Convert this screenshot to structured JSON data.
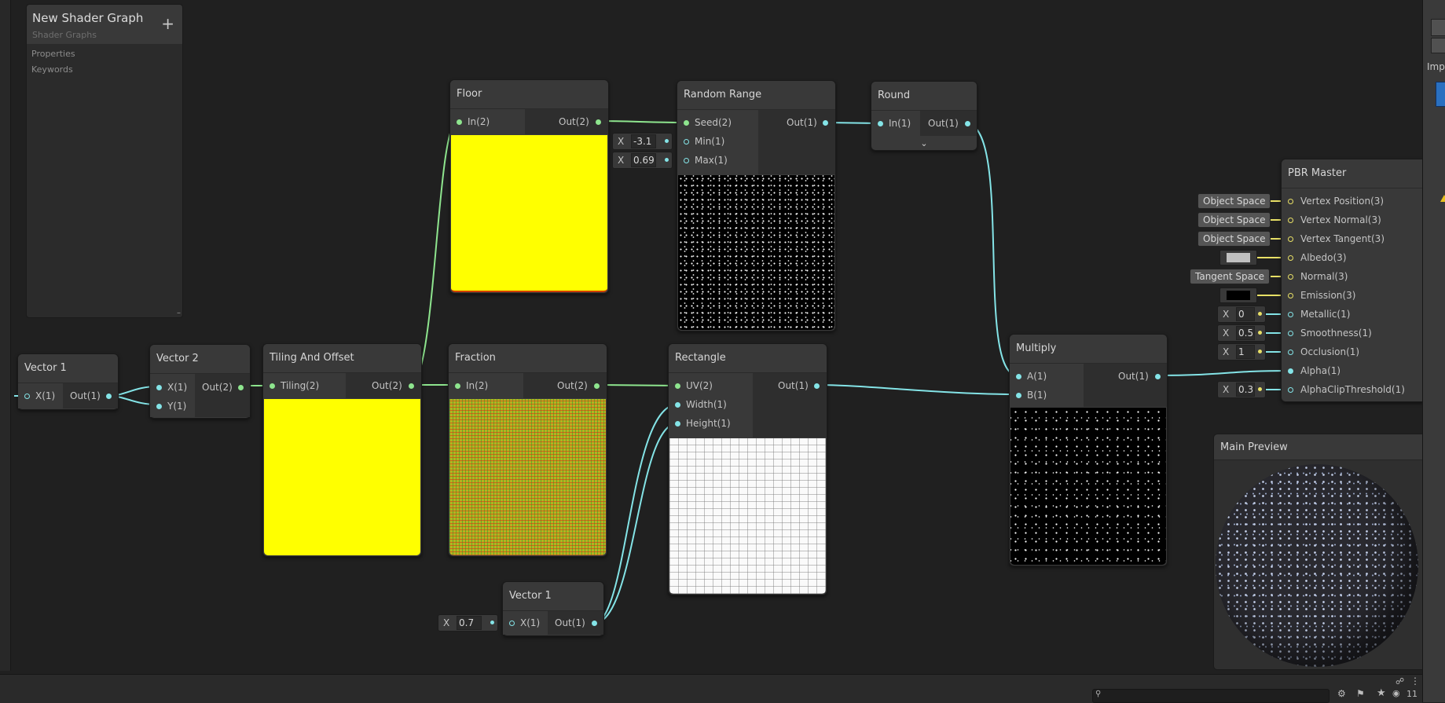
{
  "blackboard": {
    "title": "New Shader Graph",
    "subtitle": "Shader Graphs",
    "add_label": "+",
    "sections": [
      "Properties",
      "Keywords"
    ],
    "collapse_label": "–"
  },
  "nodes": {
    "vector1_a": {
      "title": "Vector 1",
      "in_label": "X(1)",
      "out_label": "Out(1)"
    },
    "vector2": {
      "title": "Vector 2",
      "in": [
        "X(1)",
        "Y(1)"
      ],
      "out_label": "Out(2)"
    },
    "tiling": {
      "title": "Tiling And Offset",
      "in_label": "Tiling(2)",
      "out_label": "Out(2)",
      "preview_color": "#ffff00"
    },
    "floor": {
      "title": "Floor",
      "in_label": "In(2)",
      "out_label": "Out(2)",
      "preview_color": "#ffff00"
    },
    "fraction": {
      "title": "Fraction",
      "in_label": "In(2)",
      "out_label": "Out(2)"
    },
    "random_range": {
      "title": "Random Range",
      "in": [
        "Seed(2)",
        "Min(1)",
        "Max(1)"
      ],
      "out_label": "Out(1)",
      "min_value": "-3.1",
      "max_value": "0.69"
    },
    "round": {
      "title": "Round",
      "in_label": "In(1)",
      "out_label": "Out(1)"
    },
    "rectangle": {
      "title": "Rectangle",
      "in": [
        "UV(2)",
        "Width(1)",
        "Height(1)"
      ],
      "out_label": "Out(1)"
    },
    "vector1_b": {
      "title": "Vector 1",
      "in_label": "X(1)",
      "out_label": "Out(1)",
      "x_value": "0.7"
    },
    "multiply": {
      "title": "Multiply",
      "in": [
        "A(1)",
        "B(1)"
      ],
      "out_label": "Out(1)"
    },
    "pbr": {
      "title": "PBR Master",
      "in": [
        "Vertex Position(3)",
        "Vertex Normal(3)",
        "Vertex Tangent(3)",
        "Albedo(3)",
        "Normal(3)",
        "Emission(3)",
        "Metallic(1)",
        "Smoothness(1)",
        "Occlusion(1)",
        "Alpha(1)",
        "AlphaClipThreshold(1)"
      ],
      "fields": {
        "vpos": "Object Space",
        "vnorm": "Object Space",
        "vtan": "Object Space",
        "normal": "Tangent Space",
        "metallic": "0",
        "smoothness": "0.5",
        "occlusion": "1",
        "alpha_clip": "0.3"
      },
      "albedo_color": "#c0c0c0",
      "emission_color": "#000000"
    }
  },
  "x_label": "X",
  "main_preview": {
    "title": "Main Preview"
  },
  "right_panel": {
    "label": "Impo"
  },
  "status": {
    "layer_count": "11"
  },
  "colors": {
    "vec2_wire": "#8ee58e",
    "vec1_wire": "#84e4e7",
    "vec3_port": "#e8e066",
    "canvas": "#202020",
    "node": "#393939"
  }
}
